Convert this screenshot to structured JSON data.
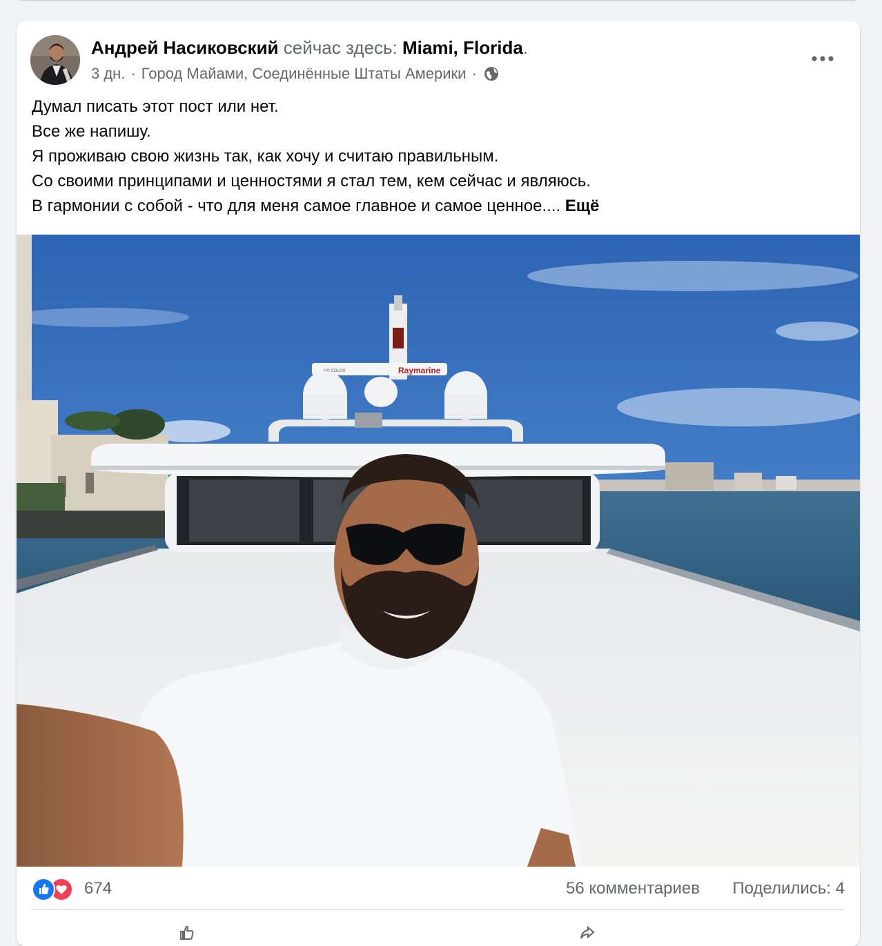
{
  "post": {
    "author": "Андрей Насиковский",
    "status_text": "сейчас здесь:",
    "place": "Miami, Florida",
    "dot": ".",
    "time": "3 дн.",
    "location": "Город Майами, Соединённые Штаты Америки",
    "meta_sep1": "·",
    "meta_sep2": "·",
    "privacy_icon": "globe-icon",
    "more_icon": "more-horizontal-icon",
    "text_lines": [
      "Думал писать этот пост или нет.",
      "Все же напишу.",
      "Я проживаю свою жизнь так, как хочу и считаю правильным.",
      "Со своими принципами и ценностями я стал тем, кем сейчас и являюсь.",
      "В гармонии с собой - что для меня самое главное и самое ценное...."
    ],
    "see_more": "Ещё",
    "photo_sign": "Raymarine",
    "photo_sign_small": "HD COLOR"
  },
  "stats": {
    "reaction_icons": [
      "like-icon",
      "love-icon"
    ],
    "reactions_count": "674",
    "comments": "56 комментариев",
    "shares": "Поделились: 4"
  },
  "colors": {
    "accent": "#1877f2",
    "love": "#f33e58",
    "secondary_text": "#65676b",
    "background": "#f0f2f5"
  }
}
